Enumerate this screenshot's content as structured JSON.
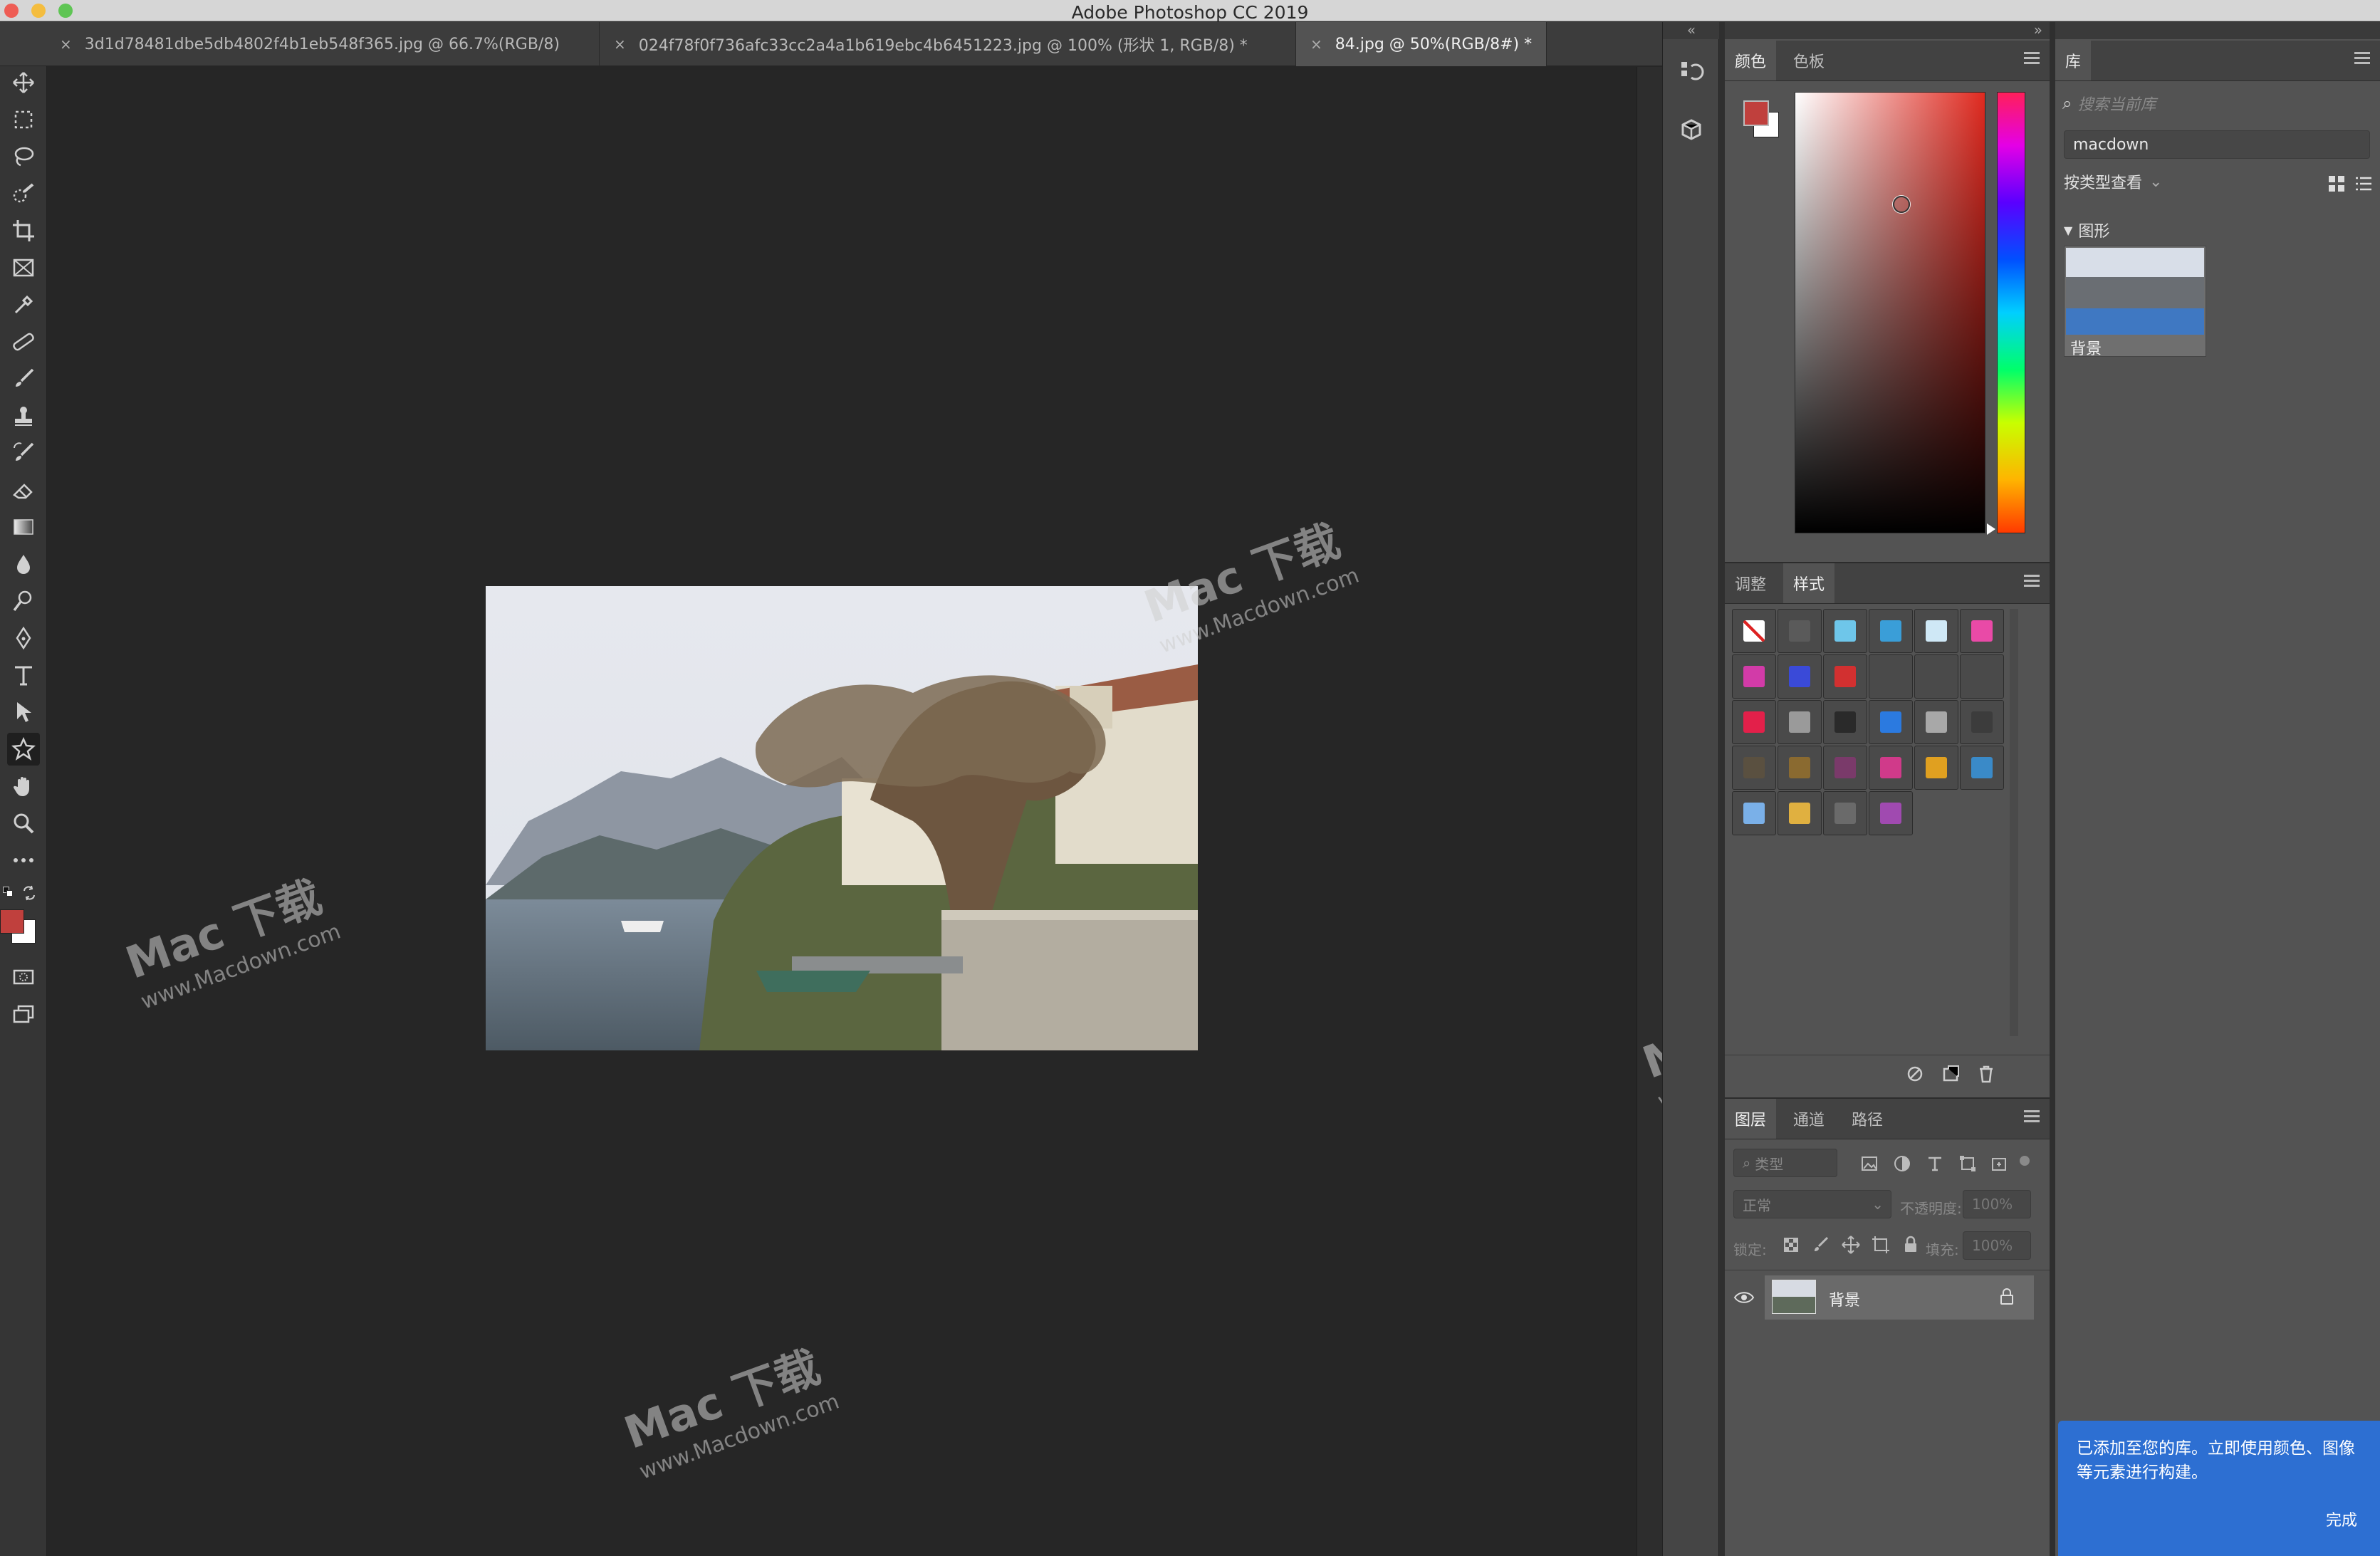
{
  "app": {
    "title": "Adobe Photoshop CC 2019"
  },
  "tabs": [
    {
      "close": "×",
      "label": "3d1d78481dbe5db4802f4b1eb548f365.jpg @ 66.7%(RGB/8)",
      "active": false
    },
    {
      "close": "×",
      "label": "024f78f0f736afc33cc2a4a1b619ebc4b6451223.jpg @ 100% (形状 1, RGB/8) *",
      "active": false
    },
    {
      "close": "×",
      "label": "84.jpg @ 50%(RGB/8#) *",
      "active": true
    }
  ],
  "colors": {
    "foreground": "#c0403d",
    "background": "#ffffff",
    "accent_blue": "#2d6fd2",
    "picker_hue": "#e02a20"
  },
  "toolbar": {
    "tools": [
      "move-tool",
      "marquee-tool",
      "lasso-tool",
      "quick-select-tool",
      "crop-tool",
      "frame-tool",
      "eyedropper-tool",
      "healing-tool",
      "brush-tool",
      "stamp-tool",
      "history-brush-tool",
      "eraser-tool",
      "gradient-tool",
      "blur-tool",
      "dodge-tool",
      "pen-tool",
      "type-tool",
      "path-select-tool",
      "shape-tool",
      "hand-tool",
      "zoom-tool",
      "more-tools"
    ]
  },
  "color_panel": {
    "tabs": [
      "颜色",
      "色板"
    ],
    "active_tab": 0
  },
  "styles_panel": {
    "tabs": [
      "调整",
      "样式"
    ],
    "active_tab": 1,
    "swatch_colors": [
      [
        "none",
        "#5a5a5a",
        "#6ec6ea",
        "#3a9ed8",
        "#cfe8f6",
        "#e94aa7"
      ],
      [
        "#d23ba8",
        "#3a4ad8",
        "#d23030",
        "#4a4a4a",
        "#4a4a4a",
        "#4a4a4a"
      ],
      [
        "#e3204a",
        "#9a9a9a",
        "#2a2a2a",
        "#2b7ae0",
        "#a8a8a8",
        "#3c3c3c"
      ],
      [
        "#5a5040",
        "#8a6a30",
        "#7a3a6a",
        "#d03a8a",
        "#e0a020",
        "#3a8ac8"
      ],
      [
        "#7ab0e8",
        "#e0b040",
        "#6a6a6a",
        "#a04ab0"
      ]
    ]
  },
  "layers_panel": {
    "tabs": [
      "图层",
      "通道",
      "路径"
    ],
    "active_tab": 0,
    "filter_placeholder": "类型",
    "blend_mode": "正常",
    "opacity_label": "不透明度:",
    "opacity_value": "100%",
    "lock_label": "锁定:",
    "fill_label": "填充:",
    "fill_value": "100%",
    "layers": [
      {
        "name": "背景",
        "visible": true,
        "locked": true
      }
    ]
  },
  "library_panel": {
    "tab": "库",
    "search_placeholder": "搜索当前库",
    "library_name": "macdown",
    "view_by": "按类型查看",
    "section": "图形",
    "items": [
      {
        "label": "背景"
      }
    ],
    "toast_text": "已添加至您的库。立即使用颜色、图像等元素进行构建。",
    "toast_button": "完成"
  },
  "watermark": {
    "brand": "Mac 下载",
    "url": "www.Macdown.com"
  }
}
